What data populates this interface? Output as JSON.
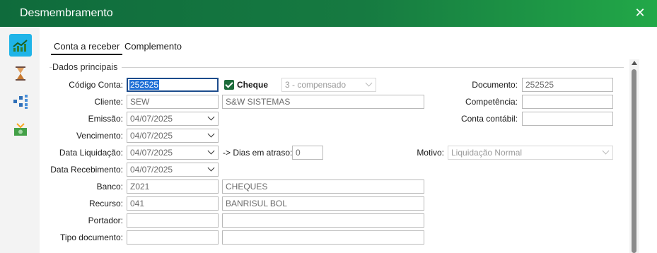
{
  "window": {
    "title": "Desmembramento"
  },
  "toolbar": {
    "icons": [
      "chart-icon",
      "hourglass-icon",
      "hierarchy-icon",
      "money-icon"
    ]
  },
  "tabs": [
    {
      "label": "Conta a receber"
    },
    {
      "label": "Complemento"
    }
  ],
  "section": {
    "title": "Dados principais"
  },
  "form": {
    "codigo_conta": {
      "label": "Código Conta:",
      "value": "252525"
    },
    "cheque": {
      "label": "Cheque",
      "checked": true,
      "status_value": "3 - compensado"
    },
    "documento": {
      "label": "Documento:",
      "value": "252525"
    },
    "cliente": {
      "label": "Cliente:",
      "code": "SEW",
      "name": "S&W SISTEMAS"
    },
    "competencia": {
      "label": "Competência:",
      "value": ""
    },
    "emissao": {
      "label": "Emissão:",
      "value": "04/07/2025"
    },
    "conta_contabil": {
      "label": "Conta contábil:",
      "value": ""
    },
    "vencimento": {
      "label": "Vencimento:",
      "value": "04/07/2025"
    },
    "data_liquidacao": {
      "label": "Data Liquidação:",
      "value": "04/07/2025"
    },
    "dias_atraso": {
      "label": "-> Dias em atraso:",
      "value": "0"
    },
    "motivo": {
      "label": "Motivo:",
      "value": "Liquidação Normal"
    },
    "data_recebimento": {
      "label": "Data Recebimento:",
      "value": "04/07/2025"
    },
    "banco": {
      "label": "Banco:",
      "code": "Z021",
      "name": "CHEQUES"
    },
    "recurso": {
      "label": "Recurso:",
      "code": "041",
      "name": "BANRISUL BOL"
    },
    "portador": {
      "label": "Portador:",
      "code": "",
      "name": ""
    },
    "tipo_documento": {
      "label": "Tipo documento:",
      "code": "",
      "name": ""
    }
  },
  "colors": {
    "title_bar_start": "#0f6b3c",
    "title_bar_end": "#22a848",
    "active_tool": "#1fb4e8",
    "checkbox": "#1c6b3a"
  }
}
